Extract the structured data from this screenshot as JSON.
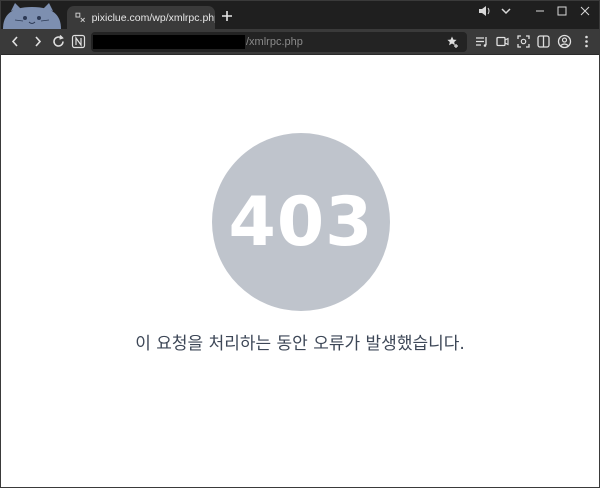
{
  "tab": {
    "title": "pixiclue.com/wp/xmlrpc.php"
  },
  "address_bar": {
    "visible_path": "/xmlrpc.php"
  },
  "error": {
    "code": "403",
    "message": "이 요청을 처리하는 동안 오류가 발생했습니다."
  },
  "colors": {
    "circle": "#bfc4cc",
    "message_text": "#3d4757",
    "chrome_dark": "#1f1f1f",
    "toolbar": "#3a3a3a"
  },
  "icons": {
    "profile": "cat-avatar-icon",
    "tab_favicon": "page-favicon-icon",
    "new_tab": "plus-icon",
    "back": "chevron-left-icon",
    "forward": "chevron-right-icon",
    "reload": "reload-icon",
    "extension": "n-extension-icon",
    "bookmark": "star-add-icon",
    "reading_list": "reading-list-icon",
    "screenshot": "screen-capture-icon",
    "media": "media-icon",
    "side_panel": "side-panel-icon",
    "account": "account-icon",
    "menu": "more-vertical-icon",
    "audio": "speaker-icon",
    "tab_list": "chevron-down-icon",
    "minimize": "minimize-icon",
    "maximize": "maximize-icon",
    "close": "close-icon"
  }
}
